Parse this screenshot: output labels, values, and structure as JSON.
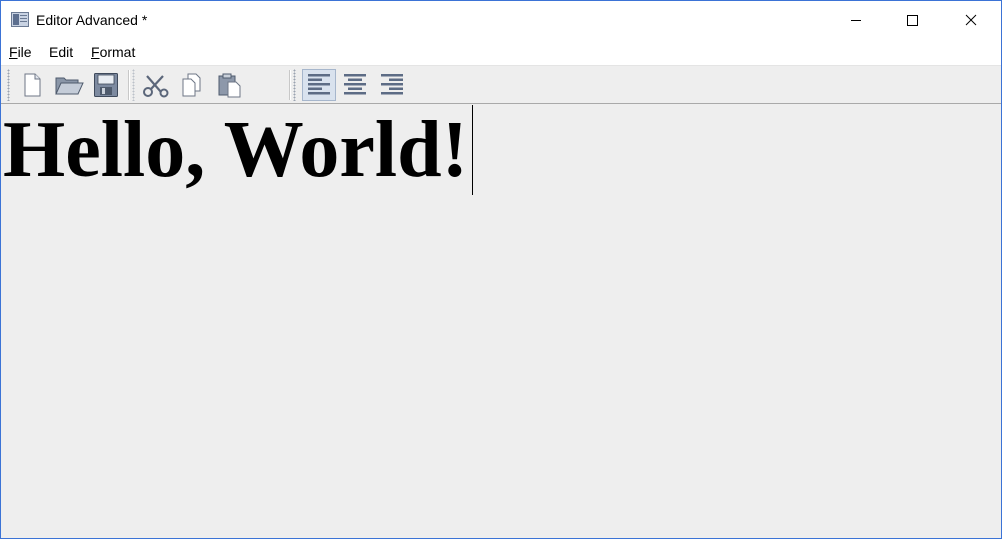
{
  "window": {
    "title": "Editor Advanced *",
    "border_color": "#3b73d6"
  },
  "caption_buttons": {
    "minimize_icon": "minimize-icon",
    "maximize_icon": "maximize-icon",
    "close_icon": "close-icon"
  },
  "menu": {
    "items": [
      {
        "mnemonic": "F",
        "rest": "ile"
      },
      {
        "mnemonic": "",
        "rest": "Edit"
      },
      {
        "mnemonic": "F",
        "rest": "ormat",
        "pre": ""
      }
    ]
  },
  "toolbar": {
    "groups": [
      [
        "new-file-icon",
        "open-folder-icon",
        "save-disk-icon"
      ],
      [
        "cut-scissors-icon",
        "copy-icon",
        "paste-icon"
      ],
      [
        "align-left-icon",
        "align-center-icon",
        "align-right-icon"
      ]
    ],
    "pressed": "align-left-icon"
  },
  "editor": {
    "content": "Hello, World!",
    "background": "#eeeeee"
  }
}
